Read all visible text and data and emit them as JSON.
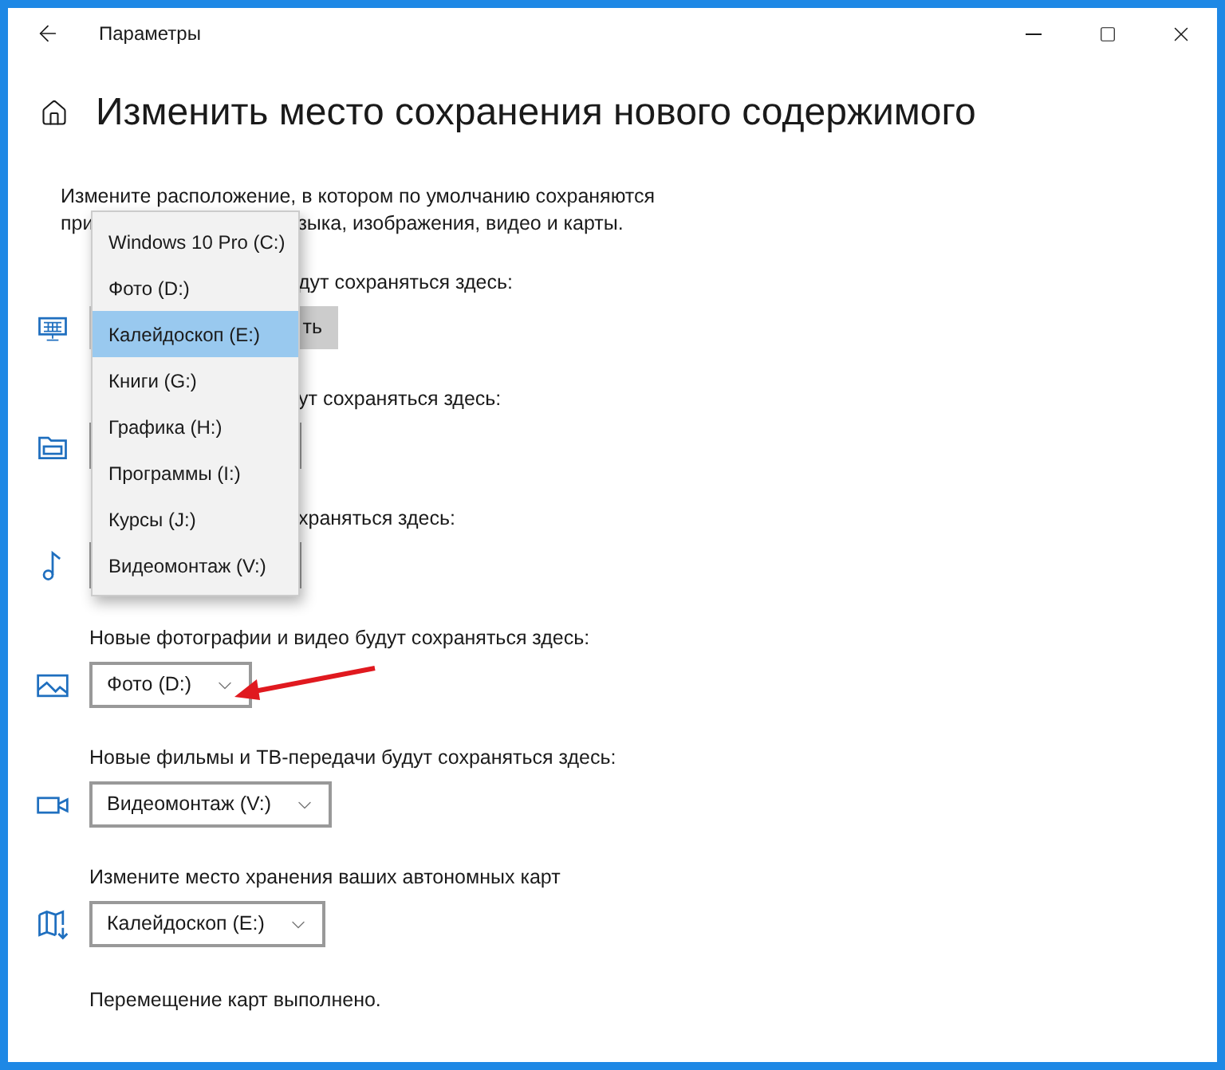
{
  "window": {
    "title": "Параметры"
  },
  "heading": "Изменить место сохранения нового содержимого",
  "description": {
    "line_1": "Измените расположение, в котором по умолчанию сохраняются",
    "line_2_start": "при",
    "line_2_end": "зыка, изображения, видео и карты."
  },
  "sections": [
    {
      "kind": "button",
      "obscured": true,
      "label": "дут сохраняться здесь:",
      "control": "ть"
    },
    {
      "kind": "select",
      "obscured": true,
      "label": "ут сохраняться здесь:"
    },
    {
      "kind": "select",
      "obscured": true,
      "label": "храняться здесь:"
    },
    {
      "kind": "select",
      "obscured": false,
      "label": "Новые фотографии и видео будут сохраняться здесь:",
      "control": "Фото (D:)"
    },
    {
      "kind": "select",
      "obscured": false,
      "label": "Новые фильмы и ТВ-передачи будут сохраняться здесь:",
      "control": "Видеомонтаж (V:)"
    },
    {
      "kind": "select",
      "obscured": false,
      "label": "Измените место хранения ваших автономных карт",
      "control": "Калейдоскоп (E:)"
    }
  ],
  "dropdown_menu": {
    "items": [
      {
        "label": "Windows 10 Pro (C:)",
        "selected": false
      },
      {
        "label": "Фото (D:)",
        "selected": false
      },
      {
        "label": "Калейдоскоп (E:)",
        "selected": true
      },
      {
        "label": "Книги (G:)",
        "selected": false
      },
      {
        "label": "Графика (H:)",
        "selected": false
      },
      {
        "label": "Программы (I:)",
        "selected": false
      },
      {
        "label": "Курсы (J:)",
        "selected": false
      },
      {
        "label": "Видеомонтаж (V:)",
        "selected": false
      }
    ]
  },
  "status": "Перемещение карт выполнено."
}
